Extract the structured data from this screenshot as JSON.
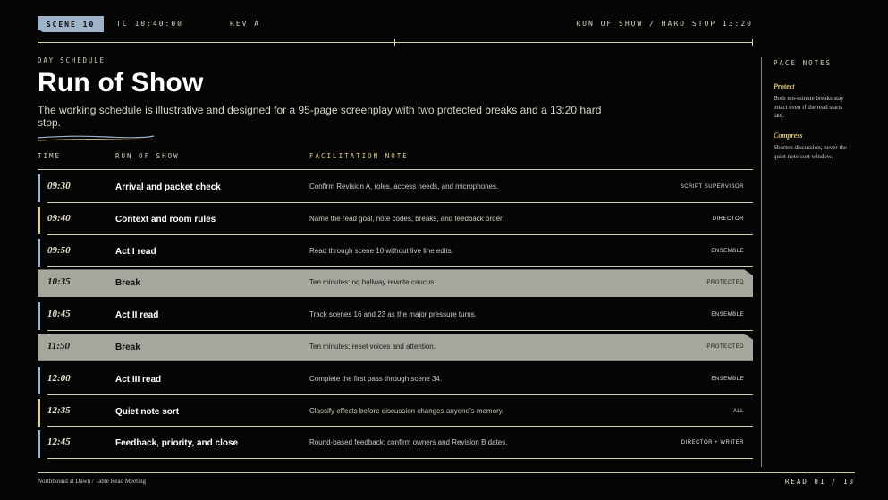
{
  "topbar": {
    "scene": "SCENE 10",
    "timecode": "TC 10:40:00",
    "revision": "REV A",
    "run_label": "RUN OF SHOW / HARD STOP 13:20"
  },
  "header": {
    "eyebrow": "DAY SCHEDULE",
    "title": "Run of Show",
    "lede": "The working schedule is illustrative and designed for a 95-page screenplay with two protected breaks and a 13:20 hard stop."
  },
  "table": {
    "headers": {
      "time": "TIME",
      "run": "RUN OF SHOW",
      "note": "FACILITATION NOTE"
    },
    "rows": [
      {
        "time": "09:30",
        "label": "Arrival and packet check",
        "note": "Confirm Revision A, roles, access needs, and microphones.",
        "owner": "SCRIPT SUPERVISOR",
        "accent": "#9fb3c8",
        "break": false
      },
      {
        "time": "09:40",
        "label": "Context and room rules",
        "note": "Name the read goal, note codes, breaks, and feedback order.",
        "owner": "DIRECTOR",
        "accent": "#d8cf9c",
        "break": false
      },
      {
        "time": "09:50",
        "label": "Act I read",
        "note": "Read through scene 10 without live line edits.",
        "owner": "ENSEMBLE",
        "accent": "#9fb3c8",
        "break": false
      },
      {
        "time": "10:35",
        "label": "Break",
        "note": "Ten minutes; no hallway rewrite caucus.",
        "owner": "PROTECTED",
        "accent": "",
        "break": true
      },
      {
        "time": "10:45",
        "label": "Act II read",
        "note": "Track scenes 16 and 23 as the major pressure turns.",
        "owner": "ENSEMBLE",
        "accent": "#9fb3c8",
        "break": false
      },
      {
        "time": "11:50",
        "label": "Break",
        "note": "Ten minutes; reset voices and attention.",
        "owner": "PROTECTED",
        "accent": "",
        "break": true
      },
      {
        "time": "12:00",
        "label": "Act III read",
        "note": "Complete the first pass through scene 34.",
        "owner": "ENSEMBLE",
        "accent": "#9fb3c8",
        "break": false
      },
      {
        "time": "12:35",
        "label": "Quiet note sort",
        "note": "Classify effects before discussion changes anyone's memory.",
        "owner": "ALL",
        "accent": "#d8cf9c",
        "break": false
      },
      {
        "time": "12:45",
        "label": "Feedback, priority, and close",
        "note": "Round-based feedback; confirm owners and Revision B dates.",
        "owner": "DIRECTOR + WRITER",
        "accent": "#9fb3c8",
        "break": false
      }
    ]
  },
  "side": {
    "title": "PACE NOTES",
    "blocks": [
      {
        "heading": "Protect",
        "text": "Both ten-minute breaks stay intact even if the read starts late."
      },
      {
        "heading": "Compress",
        "text": "Shorten discussion, never the quiet note-sort window."
      }
    ]
  },
  "footer": {
    "left": "Northbound at Dawn / Table Read Meeting",
    "right": "READ 01 / 10"
  },
  "colors": {
    "accent_blue": "#9fb3c8",
    "accent_gold": "#d8cf9c",
    "break_fill": "#a6a69d",
    "background": "#050505"
  }
}
